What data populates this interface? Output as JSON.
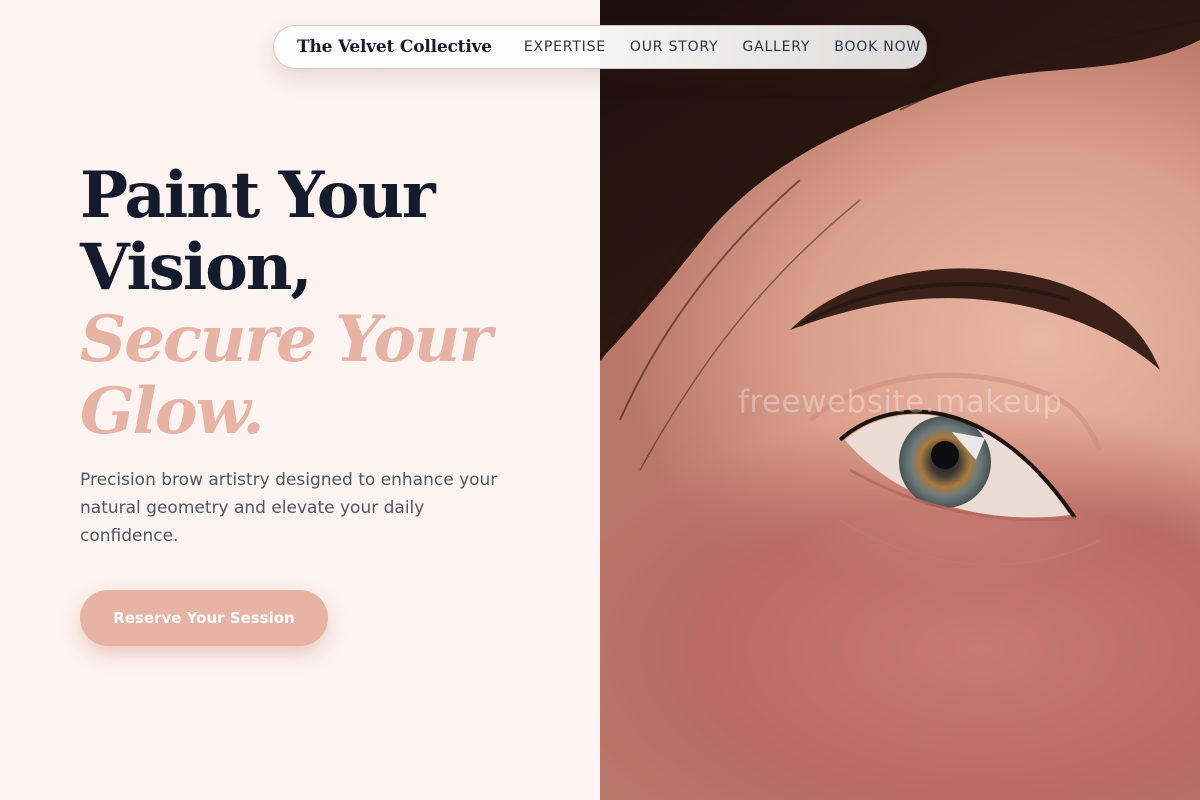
{
  "nav": {
    "brand": "The Velvet Collective",
    "links": [
      "EXPERTISE",
      "OUR STORY",
      "GALLERY",
      "BOOK NOW"
    ]
  },
  "hero": {
    "headline_lines": [
      "Paint Your",
      "Vision,"
    ],
    "accent_lines": [
      "Secure Your",
      "Glow."
    ],
    "subtext": "Precision brow artistry designed to enhance your natural geometry and elevate your daily confidence.",
    "cta_label": "Reserve Your Session"
  },
  "watermark": "freewebsite.makeup",
  "colors": {
    "background": "#fdf3f0",
    "headline": "#141b2d",
    "accent": "#e6b3a4",
    "body_text": "#4f5664",
    "button": "#e6b3a4"
  },
  "image": {
    "subject": "close-up portrait of eye and eyebrow"
  }
}
